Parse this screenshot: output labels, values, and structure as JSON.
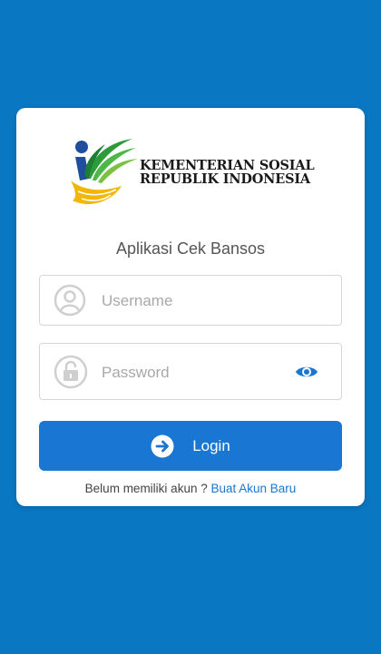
{
  "logo": {
    "line1": "KEMENTERIAN SOSIAL",
    "line2": "REPUBLIK INDONESIA"
  },
  "app_title": "Aplikasi Cek Bansos",
  "username": {
    "placeholder": "Username",
    "value": "",
    "icon": "user-circle-icon"
  },
  "password": {
    "placeholder": "Password",
    "value": "",
    "icon": "lock-circle-icon",
    "toggle_icon": "eye-icon"
  },
  "login_button": {
    "label": "Login",
    "icon": "arrow-right-circle-icon"
  },
  "signup": {
    "prompt": "Belum memiliki akun ?",
    "link": "Buat Akun Baru"
  },
  "colors": {
    "background": "#0a77c2",
    "primary": "#1976d2",
    "card": "#ffffff"
  }
}
